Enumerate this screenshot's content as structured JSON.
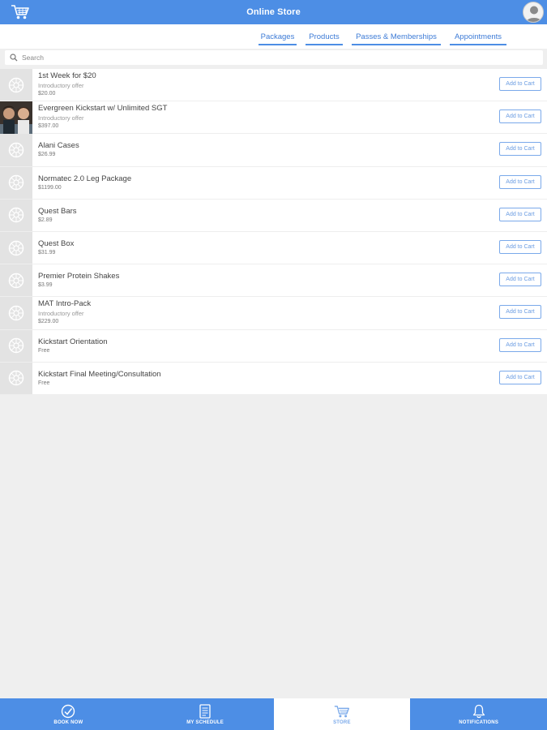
{
  "header": {
    "title": "Online Store"
  },
  "tabs": [
    {
      "label": "Packages"
    },
    {
      "label": "Products"
    },
    {
      "label": "Passes & Memberships"
    },
    {
      "label": "Appointments"
    }
  ],
  "search": {
    "placeholder": "Search"
  },
  "items": [
    {
      "name": "1st Week for $20",
      "subtitle": "Introductory offer",
      "price": "$20.00",
      "button": "Add to Cart"
    },
    {
      "name": "Evergreen Kickstart w/ Unlimited SGT",
      "subtitle": "Introductory offer",
      "price": "$397.00",
      "button": "Add to Cart"
    },
    {
      "name": "Alani Cases",
      "subtitle": "",
      "price": "$26.99",
      "button": "Add to Cart"
    },
    {
      "name": "Normatec 2.0 Leg Package",
      "subtitle": "",
      "price": "$1199.00",
      "button": "Add to Cart"
    },
    {
      "name": "Quest Bars",
      "subtitle": "",
      "price": "$2.89",
      "button": "Add to Cart"
    },
    {
      "name": "Quest Box",
      "subtitle": "",
      "price": "$31.99",
      "button": "Add to Cart"
    },
    {
      "name": "Premier Protein Shakes",
      "subtitle": "",
      "price": "$3.99",
      "button": "Add to Cart"
    },
    {
      "name": "MAT Intro-Pack",
      "subtitle": "Introductory offer",
      "price": "$229.00",
      "button": "Add to Cart"
    },
    {
      "name": "Kickstart Orientation",
      "subtitle": "",
      "price": "Free",
      "button": "Add to Cart"
    },
    {
      "name": "Kickstart Final Meeting/Consultation",
      "subtitle": "",
      "price": "Free",
      "button": "Add to Cart"
    }
  ],
  "bottom_nav": [
    {
      "label": "BOOK NOW",
      "icon": "check-circle-icon"
    },
    {
      "label": "MY SCHEDULE",
      "icon": "schedule-icon"
    },
    {
      "label": "STORE",
      "icon": "cart-icon"
    },
    {
      "label": "NOTIFICATIONS",
      "icon": "bell-icon"
    }
  ],
  "colors": {
    "primary": "#4d8ee5",
    "background": "#efefef"
  }
}
